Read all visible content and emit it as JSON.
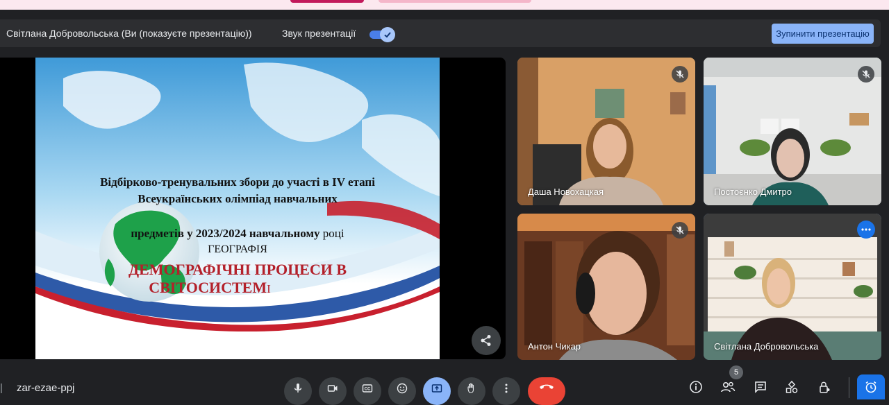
{
  "presentation_bar": {
    "presenter_text": "Світлана Добровольська (Ви (показуєте презентацію))",
    "sound_label": "Звук презентації",
    "sound_enabled": true,
    "stop_button": "Зупинити презентацію"
  },
  "slide": {
    "line1": "Відбірково-тренувальних збори  до участі в IV етапі",
    "line2": "Всеукраїнських олімпіад навчальних",
    "line3a": "предметів у 2023/2024 навчальному ",
    "line3b": "році",
    "subject": "ГЕОГРАФІЯ",
    "topic1": "ДЕМОГРАФІЧНІ ПРОЦЕСИ В",
    "topic2a": "СВІТОСИСТЕМ",
    "topic2b": "І"
  },
  "participants": [
    {
      "name": "Даша Новохацкая",
      "muted": true
    },
    {
      "name": "Постоєнко Дмитро",
      "muted": true
    },
    {
      "name": "Антон Чикар",
      "muted": true
    },
    {
      "name": "Світлана Добровольська",
      "muted": false
    }
  ],
  "bottom_bar": {
    "meeting_code": "zar-ezae-ppj",
    "participant_count": "5"
  },
  "colors": {
    "accent": "#8ab4f8",
    "hangup": "#ea4335",
    "slide_topic": "#b3202a"
  }
}
